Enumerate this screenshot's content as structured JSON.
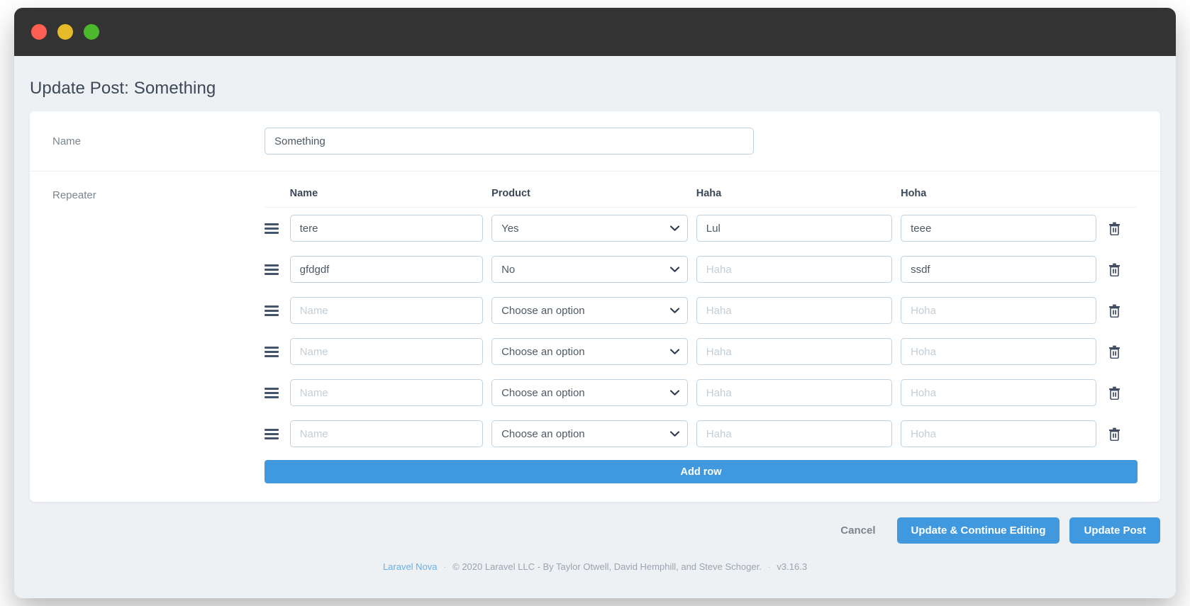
{
  "window": {
    "traffic_lights": [
      {
        "name": "close",
        "color": "#ff5f52"
      },
      {
        "name": "minimize",
        "color": "#e5bb29"
      },
      {
        "name": "maximize",
        "color": "#4cb82c"
      }
    ]
  },
  "page": {
    "title": "Update Post: Something"
  },
  "form": {
    "name_field": {
      "label": "Name",
      "value": "Something",
      "placeholder": "Name"
    },
    "repeater": {
      "label": "Repeater",
      "columns": [
        "Name",
        "Product",
        "Haha",
        "Hoha"
      ],
      "placeholders": {
        "name": "Name",
        "product": "Choose an option",
        "haha": "Haha",
        "hoha": "Hoha"
      },
      "product_options": [
        "Choose an option",
        "Yes",
        "No"
      ],
      "rows": [
        {
          "name": "tere",
          "product": "Yes",
          "haha": "Lul",
          "hoha": "teee"
        },
        {
          "name": "gfdgdf",
          "product": "No",
          "haha": "",
          "hoha": "ssdf"
        },
        {
          "name": "",
          "product": "Choose an option",
          "haha": "",
          "hoha": ""
        },
        {
          "name": "",
          "product": "Choose an option",
          "haha": "",
          "hoha": ""
        },
        {
          "name": "",
          "product": "Choose an option",
          "haha": "",
          "hoha": ""
        },
        {
          "name": "",
          "product": "Choose an option",
          "haha": "",
          "hoha": ""
        }
      ],
      "add_row_label": "Add row",
      "delete_row_title": "Delete row",
      "drag_handle_title": "Drag to reorder"
    }
  },
  "actions": {
    "cancel": "Cancel",
    "update_continue": "Update & Continue Editing",
    "update": "Update Post"
  },
  "footer": {
    "brand": "Laravel Nova",
    "separator": "·",
    "copyright": "© 2020 Laravel LLC - By Taylor Otwell, David Hemphill, and Steve Schoger.",
    "version": "v3.16.3"
  },
  "colors": {
    "accent": "#4099de",
    "title": "#3c4858",
    "muted": "#7c858e",
    "input_border": "#bdd2e2",
    "background": "#eef1f4"
  }
}
